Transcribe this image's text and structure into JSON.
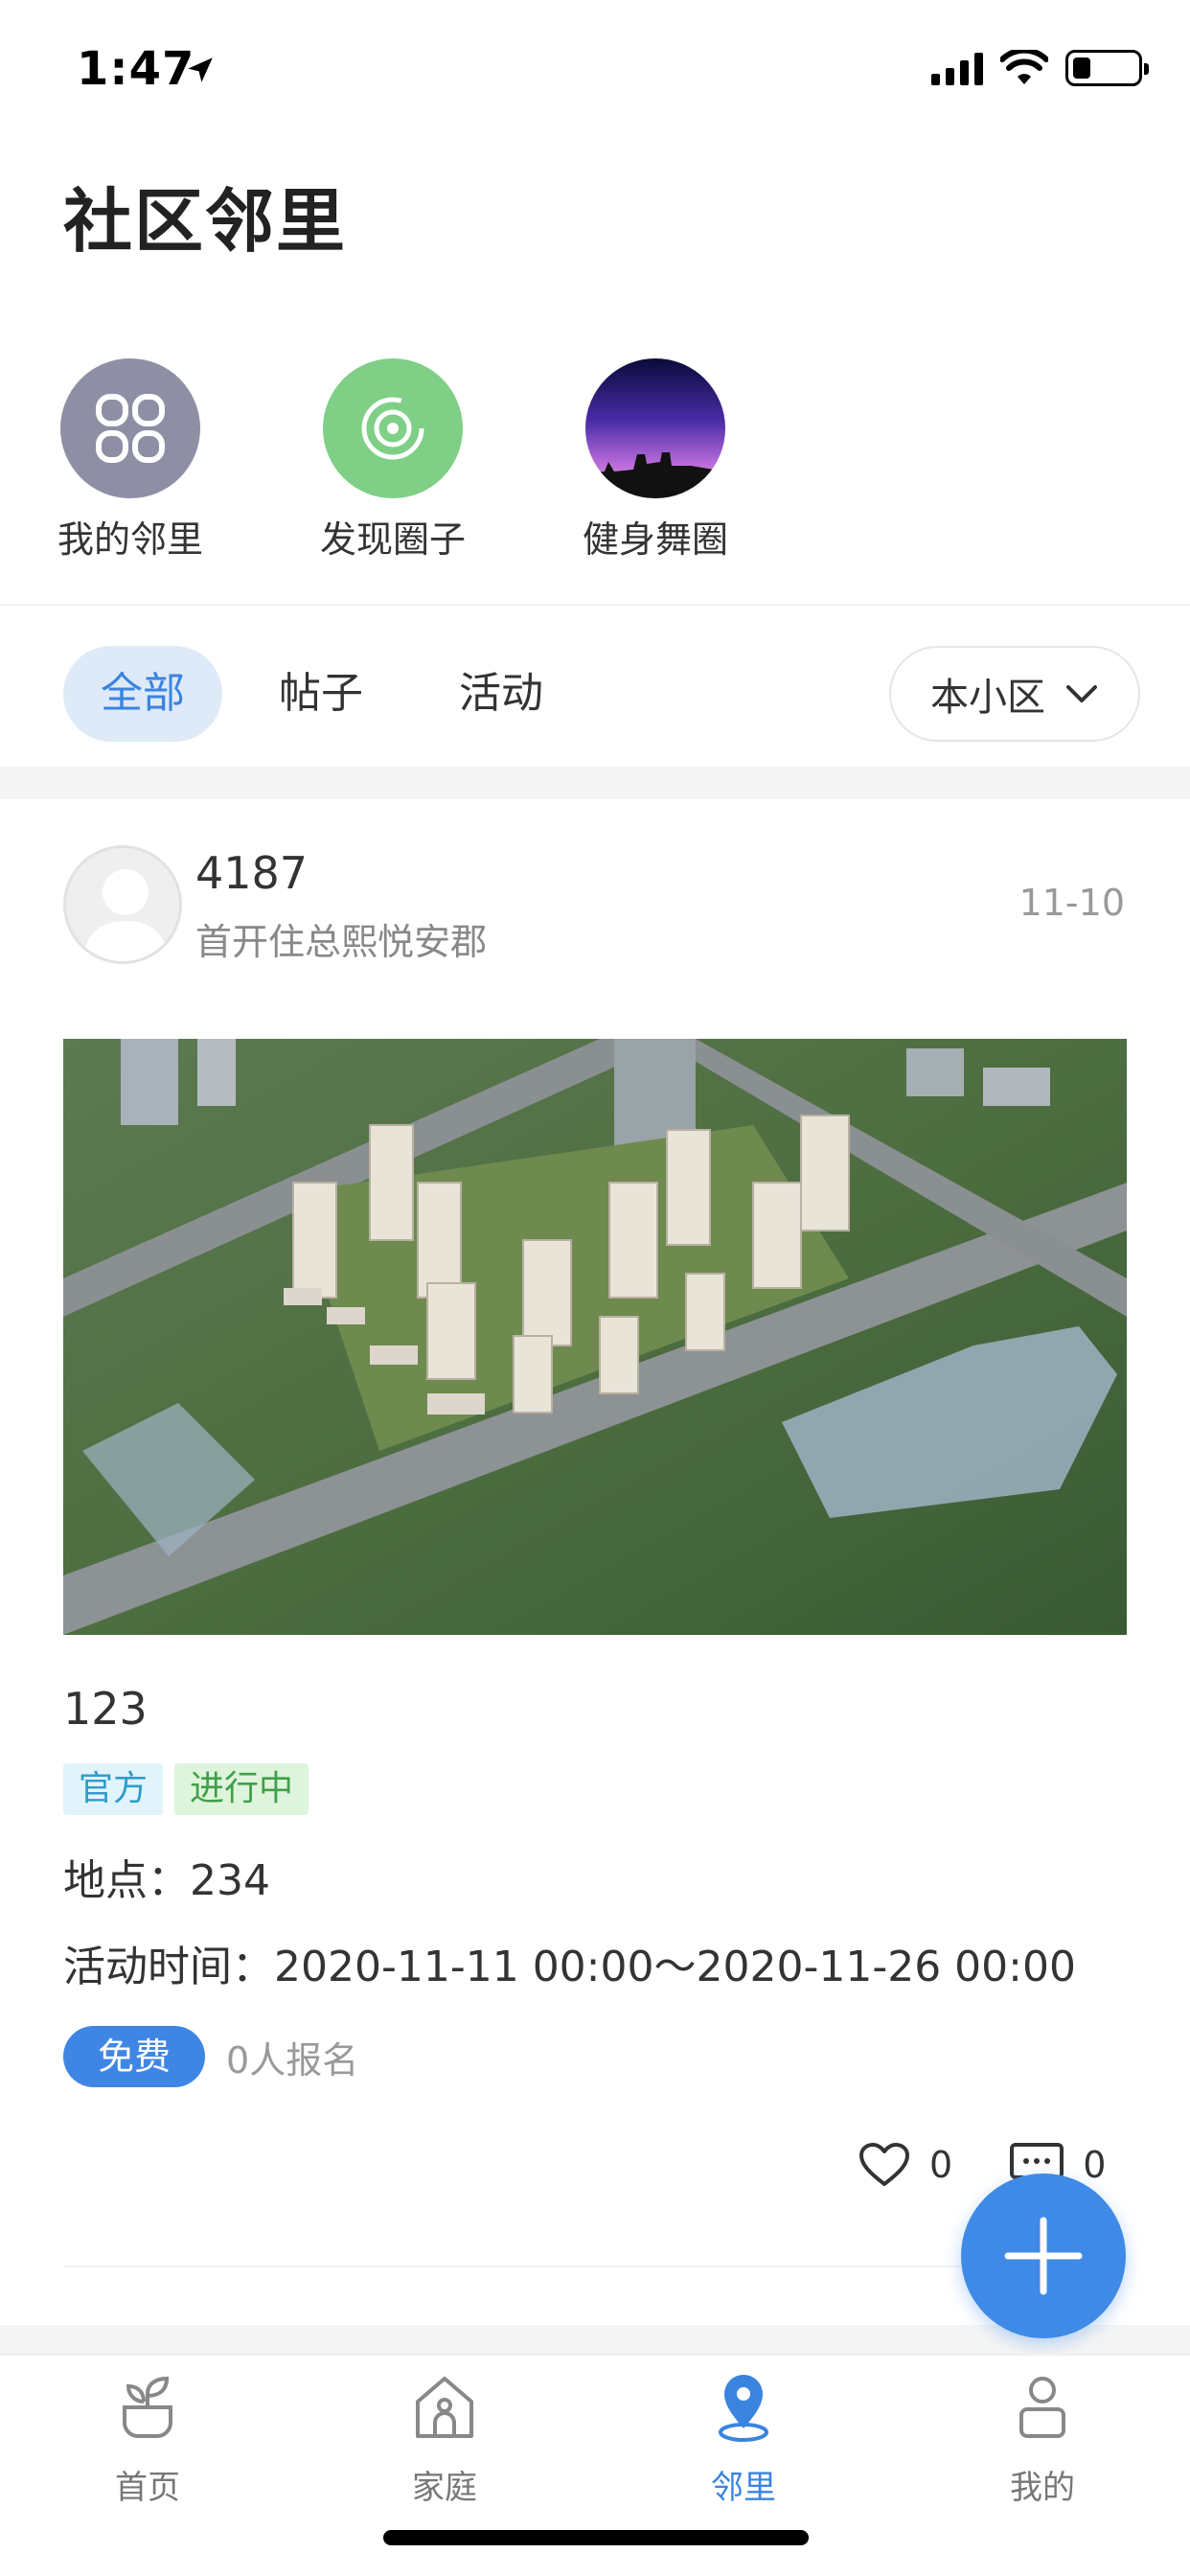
{
  "status_bar": {
    "time": "1:47",
    "battery_level": 0.28
  },
  "page": {
    "title": "社区邻里"
  },
  "circles": [
    {
      "label": "我的邻里",
      "icon": "clover-icon",
      "bg": "#8e8fa5"
    },
    {
      "label": "发现圈子",
      "icon": "target-icon",
      "bg": "#7fcf86"
    },
    {
      "label": "健身舞圈",
      "icon": "sunset-photo",
      "bg": "#4a2a8a"
    }
  ],
  "tabs": {
    "items": [
      "全部",
      "帖子",
      "活动"
    ],
    "active_index": 0,
    "scope": "本小区"
  },
  "post": {
    "author": "4187",
    "community": "首开住总熙悦安郡",
    "date": "11-10",
    "title": "123",
    "tags": [
      "官方",
      "进行中"
    ],
    "location": "地点：234",
    "time": "活动时间：2020-11-11 00:00～2020-11-26 00:00",
    "fee": "免费",
    "signup": "0人报名",
    "likes": "0",
    "comments": "0"
  },
  "nav": {
    "items": [
      {
        "label": "首页",
        "icon": "plant-icon"
      },
      {
        "label": "家庭",
        "icon": "house-icon"
      },
      {
        "label": "邻里",
        "icon": "location-pin-icon"
      },
      {
        "label": "我的",
        "icon": "person-icon"
      }
    ],
    "active_index": 2
  },
  "colors": {
    "accent": "#3f86e4",
    "accent_light": "#dfeaf8",
    "tag_official": "#2f9ccc",
    "tag_status": "#3fa048"
  }
}
